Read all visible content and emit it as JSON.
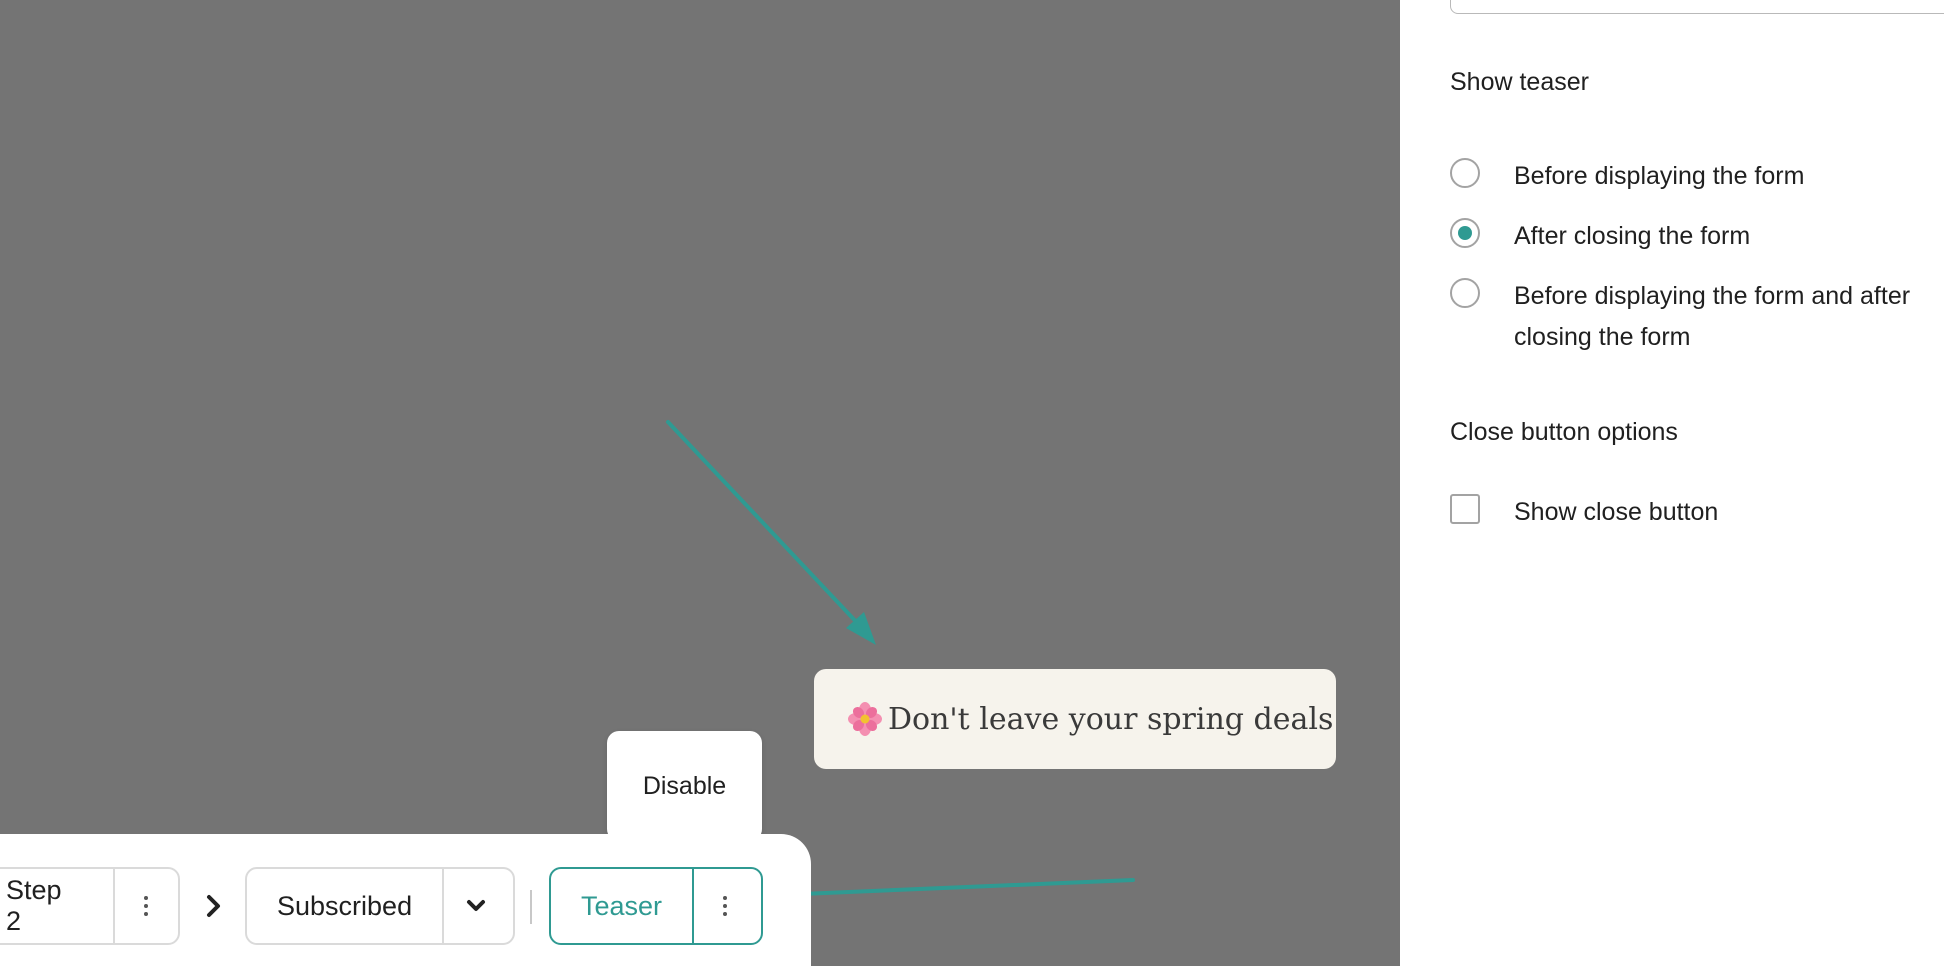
{
  "side_panel": {
    "show_teaser": {
      "title": "Show teaser",
      "options": [
        {
          "label": "Before displaying the form",
          "checked": false
        },
        {
          "label": "After closing the form",
          "checked": true
        },
        {
          "label": "Before displaying the form and after closing the form",
          "checked": false
        }
      ]
    },
    "close_button": {
      "title": "Close button options",
      "checkbox_label": "Show close button",
      "checked": false
    }
  },
  "canvas": {
    "teaser_text": "Don't leave your spring deals",
    "teaser_icon": "flower-icon",
    "popover_label": "Disable"
  },
  "step_bar": {
    "step2_label": "Step 2",
    "subscribed_label": "Subscribed",
    "teaser_label": "Teaser"
  },
  "colors": {
    "accent": "#2f9a92",
    "canvas_bg": "#747474",
    "teaser_bg": "#f6f3ec"
  }
}
